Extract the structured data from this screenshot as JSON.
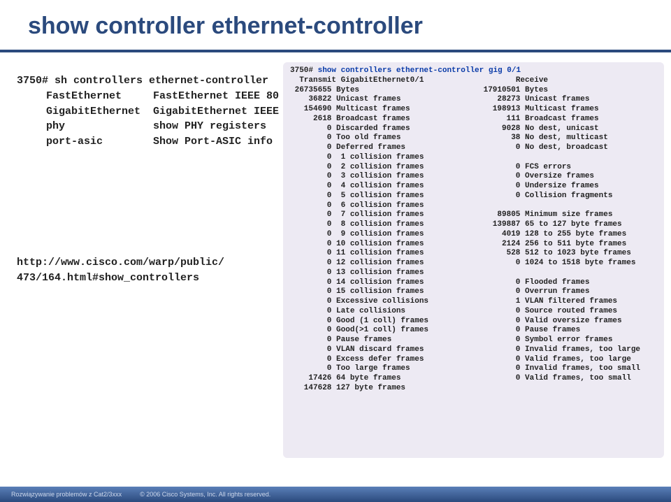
{
  "title": "show controller ethernet-controller",
  "left": {
    "line1": "3750# sh controllers ethernet-controller",
    "opts": [
      [
        "FastEthernet",
        "FastEthernet IEEE 80"
      ],
      [
        "GigabitEthernet",
        "GigabitEthernet IEEE"
      ],
      [
        "phy",
        "show PHY registers"
      ],
      [
        "port-asic",
        "Show Port-ASIC info"
      ]
    ],
    "url_l1": "http://www.cisco.com/warp/public/",
    "url_l2": "473/164.html#show_controllers"
  },
  "right": {
    "prompt": "3750# ",
    "cmd": "show controllers ethernet-controller gig 0/1",
    "header_tx": "Transmit GigabitEthernet0/1",
    "header_rx": "Receive",
    "rows": [
      [
        "26735655",
        "Bytes",
        "17910501",
        "Bytes"
      ],
      [
        "36822",
        "Unicast frames",
        "28273",
        "Unicast frames"
      ],
      [
        "154690",
        "Multicast frames",
        "198913",
        "Multicast frames"
      ],
      [
        "2618",
        "Broadcast frames",
        "111",
        "Broadcast frames"
      ],
      [
        "0",
        "Discarded frames",
        "9028",
        "No dest, unicast"
      ],
      [
        "0",
        "Too old frames",
        "38",
        "No dest, multicast"
      ],
      [
        "0",
        "Deferred frames",
        "0",
        "No dest, broadcast"
      ],
      [
        "0",
        " 1 collision frames",
        "",
        ""
      ],
      [
        "0",
        " 2 collision frames",
        "0",
        "FCS errors"
      ],
      [
        "0",
        " 3 collision frames",
        "0",
        "Oversize frames"
      ],
      [
        "0",
        " 4 collision frames",
        "0",
        "Undersize frames"
      ],
      [
        "0",
        " 5 collision frames",
        "0",
        "Collision fragments"
      ],
      [
        "0",
        " 6 collision frames",
        "",
        ""
      ],
      [
        "0",
        " 7 collision frames",
        "89805",
        "Minimum size frames"
      ],
      [
        "0",
        " 8 collision frames",
        "139887",
        "65 to 127 byte frames"
      ],
      [
        "0",
        " 9 collision frames",
        "4019",
        "128 to 255 byte frames"
      ],
      [
        "0",
        "10 collision frames",
        "2124",
        "256 to 511 byte frames"
      ],
      [
        "0",
        "11 collision frames",
        "528",
        "512 to 1023 byte frames"
      ],
      [
        "0",
        "12 collision frames",
        "0",
        "1024 to 1518 byte frames"
      ],
      [
        "0",
        "13 collision frames",
        "",
        ""
      ],
      [
        "0",
        "14 collision frames",
        "0",
        "Flooded frames"
      ],
      [
        "0",
        "15 collision frames",
        "0",
        "Overrun frames"
      ],
      [
        "0",
        "Excessive collisions",
        "1",
        "VLAN filtered frames"
      ],
      [
        "0",
        "Late collisions",
        "0",
        "Source routed frames"
      ],
      [
        "0",
        "Good (1 coll) frames",
        "0",
        "Valid oversize frames"
      ],
      [
        "0",
        "Good(>1 coll) frames",
        "0",
        "Pause frames"
      ],
      [
        "0",
        "Pause frames",
        "0",
        "Symbol error frames"
      ],
      [
        "0",
        "VLAN discard frames",
        "0",
        "Invalid frames, too large"
      ],
      [
        "0",
        "Excess defer frames",
        "0",
        "Valid frames, too large"
      ],
      [
        "0",
        "Too large frames",
        "0",
        "Invalid frames, too small"
      ],
      [
        "17426",
        "64 byte frames",
        "0",
        "Valid frames, too small"
      ],
      [
        "147628",
        "127 byte frames",
        "",
        ""
      ]
    ]
  },
  "footer": {
    "l": "Rozwiązywanie problemów z Cat2/3xxx",
    "c": "© 2006 Cisco Systems, Inc. All rights reserved."
  }
}
